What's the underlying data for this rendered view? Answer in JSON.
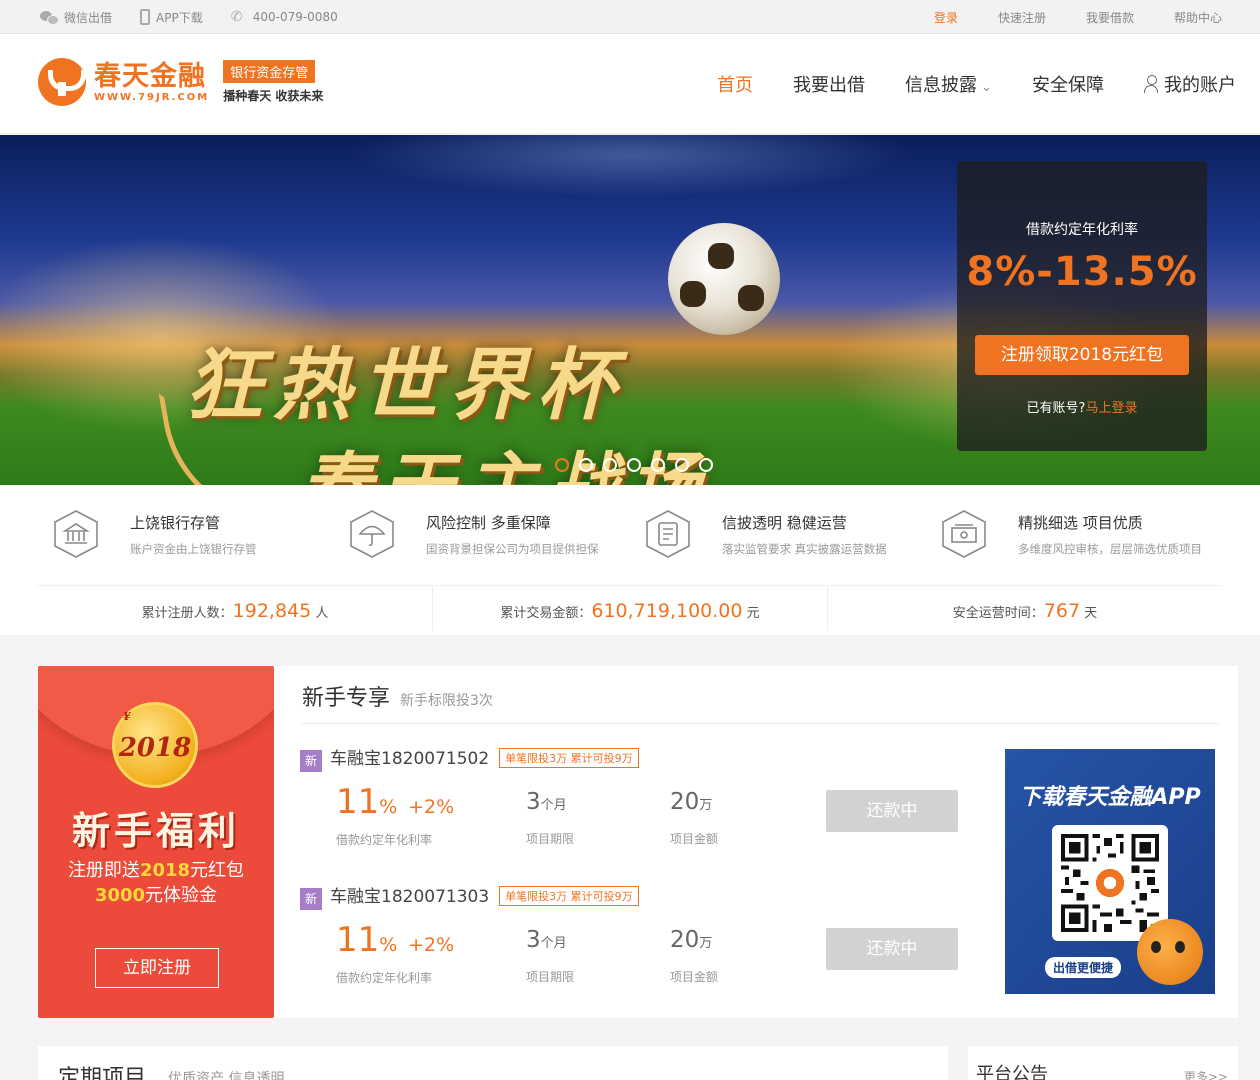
{
  "topbar": {
    "wechat": "微信出借",
    "app": "APP下载",
    "phone": "400-079-0080",
    "login": "登录",
    "register": "快速注册",
    "borrow": "我要借款",
    "help": "帮助中心"
  },
  "header": {
    "logo_name": "春天金融",
    "logo_url": "WWW.79JR.COM",
    "badge": "银行资金存管",
    "slogan": "播种春天 收获未来",
    "nav": [
      "首页",
      "我要出借",
      "信息披露",
      "安全保障",
      "我的账户"
    ]
  },
  "banner": {
    "title_line1": "狂热世界杯",
    "title_line2": "春天主战场",
    "panel_label": "借款约定年化利率",
    "panel_rate": "8%-13.5%",
    "panel_button": "注册领取2018元红包",
    "panel_have": "已有账号?",
    "panel_login": "马上登录",
    "slide_count": 7,
    "active_slide": 1
  },
  "features": [
    {
      "title": "上饶银行存管",
      "desc": "账户资金由上饶银行存管",
      "icon": "bank-icon"
    },
    {
      "title": "风险控制 多重保障",
      "desc": "国资背景担保公司为项目提供担保",
      "icon": "umbrella-icon"
    },
    {
      "title": "信披透明 稳健运营",
      "desc": "落实监管要求 真实披露运营数据",
      "icon": "document-icon"
    },
    {
      "title": "精挑细选 项目优质",
      "desc": "多维度风控审核，层层筛选优质项目",
      "icon": "cash-icon"
    }
  ],
  "stats": [
    {
      "label": "累计注册人数：",
      "value": "192,845",
      "unit": "人"
    },
    {
      "label": "累计交易金额：",
      "value": "610,719,100.00",
      "unit": "元"
    },
    {
      "label": "安全运营时间：",
      "value": "767",
      "unit": "天"
    }
  ],
  "redpack": {
    "coin_year": "2018",
    "coin_symbol": "¥",
    "title": "新手福利",
    "line1_pre": "注册即送",
    "line1_amount": "2018",
    "line1_unit": "元",
    "line1_post": "红包",
    "line2_amount": "3000",
    "line2_unit": "元",
    "line2_post": "体验金",
    "cta": "立即注册"
  },
  "newbie": {
    "title": "新手专享",
    "subtitle": "新手标限投3次",
    "loans": [
      {
        "tag": "新",
        "name": "车融宝1820071502",
        "limit": "单笔限投3万 累计可投9万",
        "rate": "11",
        "rate_unit": "%",
        "bonus": "+2%",
        "rate_label": "借款约定年化利率",
        "term": "3",
        "term_unit": "个月",
        "term_label": "项目期限",
        "amount": "20",
        "amount_unit": "万",
        "amount_label": "项目金额",
        "status": "还款中"
      },
      {
        "tag": "新",
        "name": "车融宝1820071303",
        "limit": "单笔限投3万 累计可投9万",
        "rate": "11",
        "rate_unit": "%",
        "bonus": "+2%",
        "rate_label": "借款约定年化利率",
        "term": "3",
        "term_unit": "个月",
        "term_label": "项目期限",
        "amount": "20",
        "amount_unit": "万",
        "amount_label": "项目金额",
        "status": "还款中"
      }
    ],
    "app_title": "下载春天金融APP",
    "app_pill": "出借更便捷"
  },
  "bottom": {
    "fixed_title": "定期项目",
    "fixed_sub": "优质资产 信息透明",
    "notice_title": "平台公告",
    "notice_more": "更多>>"
  },
  "colors": {
    "accent": "#f07322",
    "red": "#ec4a3a",
    "tag_purple": "#a67ec8"
  }
}
